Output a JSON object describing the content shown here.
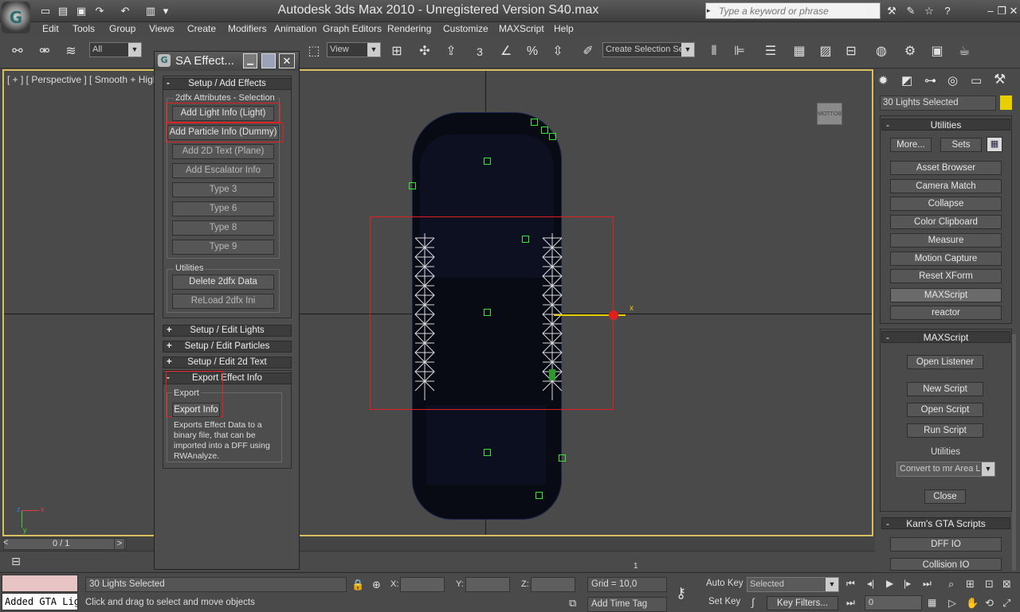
{
  "titlebar": {
    "title": "Autodesk 3ds Max  2010  - Unregistered Version   S40.max",
    "search_placeholder": "Type a keyword or phrase"
  },
  "menu": [
    "Edit",
    "Tools",
    "Group",
    "Views",
    "Create",
    "Modifiers",
    "Animation",
    "Graph Editors",
    "Rendering",
    "Customize",
    "MAXScript",
    "Help"
  ],
  "toolbar": {
    "filter_combo": "All",
    "view_combo": "View",
    "snap_label": "3",
    "selection_set_combo": "Create Selection Se"
  },
  "viewport": {
    "label": "[ + ] [ Perspective ] [ Smooth + Highligh",
    "viewcube_label": "BOTTOM",
    "gizmo_axis": "x",
    "frame_counter": "0 / 1",
    "axis_labels": {
      "x": "x",
      "y": "y",
      "z": "z"
    }
  },
  "sa_window": {
    "title": "SA Effect...",
    "setup_add_effects": "Setup / Add Effects",
    "attributes_group": "2dfx Attributes - Selection",
    "buttons": [
      {
        "label": "Add Light Info (Light)",
        "enabled": true
      },
      {
        "label": "Add Particle Info (Dummy)",
        "enabled": true
      },
      {
        "label": "Add 2D Text (Plane)",
        "enabled": false
      },
      {
        "label": "Add Escalator Info",
        "enabled": false
      },
      {
        "label": "Type 3",
        "enabled": false
      },
      {
        "label": "Type 6",
        "enabled": false
      },
      {
        "label": "Type 8",
        "enabled": false
      },
      {
        "label": "Type 9",
        "enabled": false
      }
    ],
    "utilities_group": "Utilities",
    "delete_btn": "Delete 2dfx Data",
    "reload_btn": "ReLoad 2dfx Ini",
    "rollouts": [
      {
        "sign": "+",
        "label": "Setup / Edit Lights"
      },
      {
        "sign": "+",
        "label": "Setup / Edit Particles"
      },
      {
        "sign": "+",
        "label": "Setup / Edit 2d Text"
      },
      {
        "sign": "-",
        "label": "Export Effect Info"
      }
    ],
    "export_group": "Export",
    "export_btn": "Export Info",
    "export_desc": "Exports Effect Data to a binary file, that can be imported into a DFF using RWAnalyze."
  },
  "command_panel": {
    "selection_name": "30 Lights Selected",
    "utilities_title": "Utilities",
    "more_btn": "More...",
    "sets_btn": "Sets",
    "utility_items": [
      "Asset Browser",
      "Camera Match",
      "Collapse",
      "Color Clipboard",
      "Measure",
      "Motion Capture",
      "Reset XForm",
      "MAXScript",
      "reactor"
    ],
    "maxscript_title": "MAXScript",
    "open_listener": "Open Listener",
    "new_script": "New Script",
    "open_script": "Open Script",
    "run_script": "Run Script",
    "utilities_label": "Utilities",
    "utilities_combo": "Convert to mr Area L",
    "close_btn": "Close",
    "kams_title": "Kam's GTA Scripts",
    "dff_io": "DFF IO",
    "collision_io": "Collision IO"
  },
  "status": {
    "listener_text": "Added GTA Lig",
    "selection_status": "30 Lights Selected",
    "prompt": "Click and drag to select and move objects",
    "x_label": "X:",
    "y_label": "Y:",
    "z_label": "Z:",
    "grid": "Grid = 10,0",
    "add_time_tag": "Add Time Tag",
    "auto_key": "Auto Key",
    "set_key": "Set Key",
    "key_mode_combo": "Selected",
    "key_filters": "Key Filters...",
    "frame_field": "0",
    "track_mark": "1"
  },
  "colors": {
    "accent_yellow": "#e8d000",
    "highlight_red": "#e02020",
    "helper_green": "#38e838"
  }
}
